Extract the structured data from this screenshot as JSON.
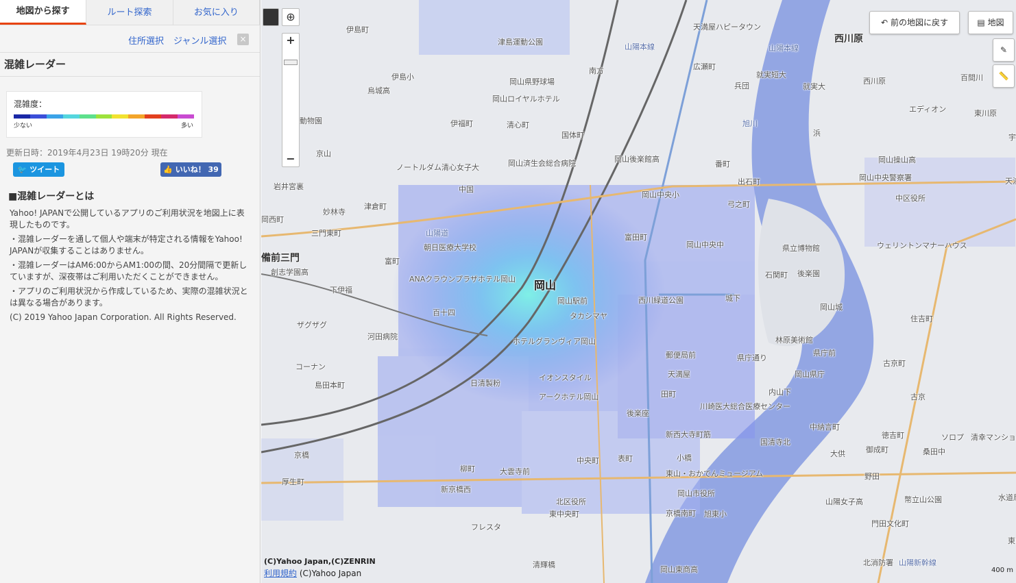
{
  "tabs": [
    "地図から探す",
    "ルート探索",
    "お気に入り"
  ],
  "subnav": {
    "address": "住所選択",
    "genre": "ジャンル選択",
    "close": "×"
  },
  "panel_title": "混雑レーダー",
  "legend": {
    "label": "混雑度：",
    "min": "少ない",
    "max": "多い",
    "colors": [
      "#1a28a6",
      "#3b4fd9",
      "#3ba3e8",
      "#55d6de",
      "#5ee08c",
      "#9ee23c",
      "#f2e230",
      "#f3a52a",
      "#e2401f",
      "#d42a6b",
      "#c94bd1"
    ]
  },
  "updated": "更新日時：2019年4月23日 19時20分 現在",
  "tweet_label": "ツイート",
  "like_label": "いいね！ 39",
  "about_title": "■混雑レーダーとは",
  "about_paragraphs": [
    "Yahoo! JAPANで公開しているアプリのご利用状況を地図上に表現したものです。",
    "・混雑レーダーを通して個人や端末が特定される情報をYahoo! JAPANが収集することはありません。",
    "・混雑レーダーはAM6:00からAM1:00の間、20分間隔で更新していますが、深夜帯はご利用いただくことができません。",
    "・アプリのご利用状況から作成しているため、実際の混雑状況とは異なる場合があります。",
    "(C) 2019 Yahoo Japan Corporation. All Rights Reserved."
  ],
  "map": {
    "back_button": "前の地図に戻す",
    "layer_button": "地図",
    "zoom_in": "+",
    "zoom_out": "−",
    "copyright": "(C)Yahoo Japan,(C)ZENRIN",
    "terms": "利用規約",
    "copyright2": "(C)Yahoo Japan",
    "scale": "400 m",
    "labels": [
      {
        "t": "伊島町"
      },
      {
        "t": "津島運動公園"
      },
      {
        "t": "天満屋ハピータウン"
      },
      {
        "t": "西川原",
        "cls": "big"
      },
      {
        "t": "伊島小"
      },
      {
        "t": "烏城高"
      },
      {
        "t": "南方"
      },
      {
        "t": "広瀬町"
      },
      {
        "t": "山陽本線",
        "cls": "road"
      },
      {
        "t": "就実短大"
      },
      {
        "t": "就実大"
      },
      {
        "t": "西川原"
      },
      {
        "t": "百間川"
      },
      {
        "t": "岡山県野球場"
      },
      {
        "t": "岡山ロイヤルホテル"
      },
      {
        "t": "兵団"
      },
      {
        "t": "エディオン"
      },
      {
        "t": "東川原"
      },
      {
        "t": "池田動物園"
      },
      {
        "t": "伊福町"
      },
      {
        "t": "清心町"
      },
      {
        "t": "国体町"
      },
      {
        "t": "旭川",
        "cls": "road"
      },
      {
        "t": "浜"
      },
      {
        "t": "宇野小"
      },
      {
        "t": "京山"
      },
      {
        "t": "ノートルダム清心女子大"
      },
      {
        "t": "岡山済生会総合病院"
      },
      {
        "t": "岡山後楽館高"
      },
      {
        "t": "番町"
      },
      {
        "t": "岡山操山高"
      },
      {
        "t": "岡山中央警察署"
      },
      {
        "t": "天満"
      },
      {
        "t": "岩井宮裏"
      },
      {
        "t": "中国"
      },
      {
        "t": "岡山中央小"
      },
      {
        "t": "出石町"
      },
      {
        "t": "妙林寺"
      },
      {
        "t": "津倉町"
      },
      {
        "t": "弓之町"
      },
      {
        "t": "中区役所"
      },
      {
        "t": "岡西町"
      },
      {
        "t": "三門東町"
      },
      {
        "t": "山陽道",
        "cls": "road"
      },
      {
        "t": "朝日医療大学校"
      },
      {
        "t": "富田町"
      },
      {
        "t": "岡山中央中"
      },
      {
        "t": "県立博物館"
      },
      {
        "t": "ウェリントンマナーハウス"
      },
      {
        "t": "備前三門",
        "cls": "big"
      },
      {
        "t": "創志学園高"
      },
      {
        "t": "富町"
      },
      {
        "t": "石関町"
      },
      {
        "t": "後楽園"
      },
      {
        "t": "ANAクラウンプラザホテル岡山"
      },
      {
        "t": "岡山",
        "cls": "sta"
      },
      {
        "t": "下伊福"
      },
      {
        "t": "岡山駅前"
      },
      {
        "t": "西川緑道公園"
      },
      {
        "t": "城下"
      },
      {
        "t": "岡山城"
      },
      {
        "t": "百十四"
      },
      {
        "t": "タカシマヤ"
      },
      {
        "t": "ザグザグ"
      },
      {
        "t": "住吉町"
      },
      {
        "t": "河田病院"
      },
      {
        "t": "ホテルグランヴィア岡山"
      },
      {
        "t": "林原美術館"
      },
      {
        "t": "郵便局前"
      },
      {
        "t": "県庁通り"
      },
      {
        "t": "県庁前"
      },
      {
        "t": "古京町"
      },
      {
        "t": "コーナン"
      },
      {
        "t": "天満屋"
      },
      {
        "t": "岡山県庁"
      },
      {
        "t": "日清製粉"
      },
      {
        "t": "イオンスタイル"
      },
      {
        "t": "島田本町"
      },
      {
        "t": "内山下"
      },
      {
        "t": "アークホテル岡山"
      },
      {
        "t": "田町"
      },
      {
        "t": "川崎医大総合医療センター"
      },
      {
        "t": "古京"
      },
      {
        "t": "後楽座"
      },
      {
        "t": "新西大寺町筋"
      },
      {
        "t": "中納言町"
      },
      {
        "t": "徳吉町"
      },
      {
        "t": "ソロプ"
      },
      {
        "t": "清幸マンション野田"
      },
      {
        "t": "京橋"
      },
      {
        "t": "国清寺北"
      },
      {
        "t": "御成町"
      },
      {
        "t": "桑田中"
      },
      {
        "t": "柳町"
      },
      {
        "t": "中央町"
      },
      {
        "t": "表町"
      },
      {
        "t": "小橋"
      },
      {
        "t": "大供"
      },
      {
        "t": "大雲寺前"
      },
      {
        "t": "東山・おかでんミュージアム"
      },
      {
        "t": "野田"
      },
      {
        "t": "厚生町"
      },
      {
        "t": "新京橋西"
      },
      {
        "t": "岡山市役所"
      },
      {
        "t": "北区役所"
      },
      {
        "t": "東中央町"
      },
      {
        "t": "京橋南町"
      },
      {
        "t": "旭東小"
      },
      {
        "t": "山陽女子高"
      },
      {
        "t": "幣立山公園"
      },
      {
        "t": "水道局前"
      },
      {
        "t": "フレスタ"
      },
      {
        "t": "門田文化町"
      },
      {
        "t": "東山中"
      },
      {
        "t": "北消防署"
      },
      {
        "t": "清輝橋"
      },
      {
        "t": "岡山東商高"
      },
      {
        "t": "山陽新幹線",
        "cls": "road"
      },
      {
        "t": "山陽本線",
        "cls": "road"
      }
    ]
  }
}
